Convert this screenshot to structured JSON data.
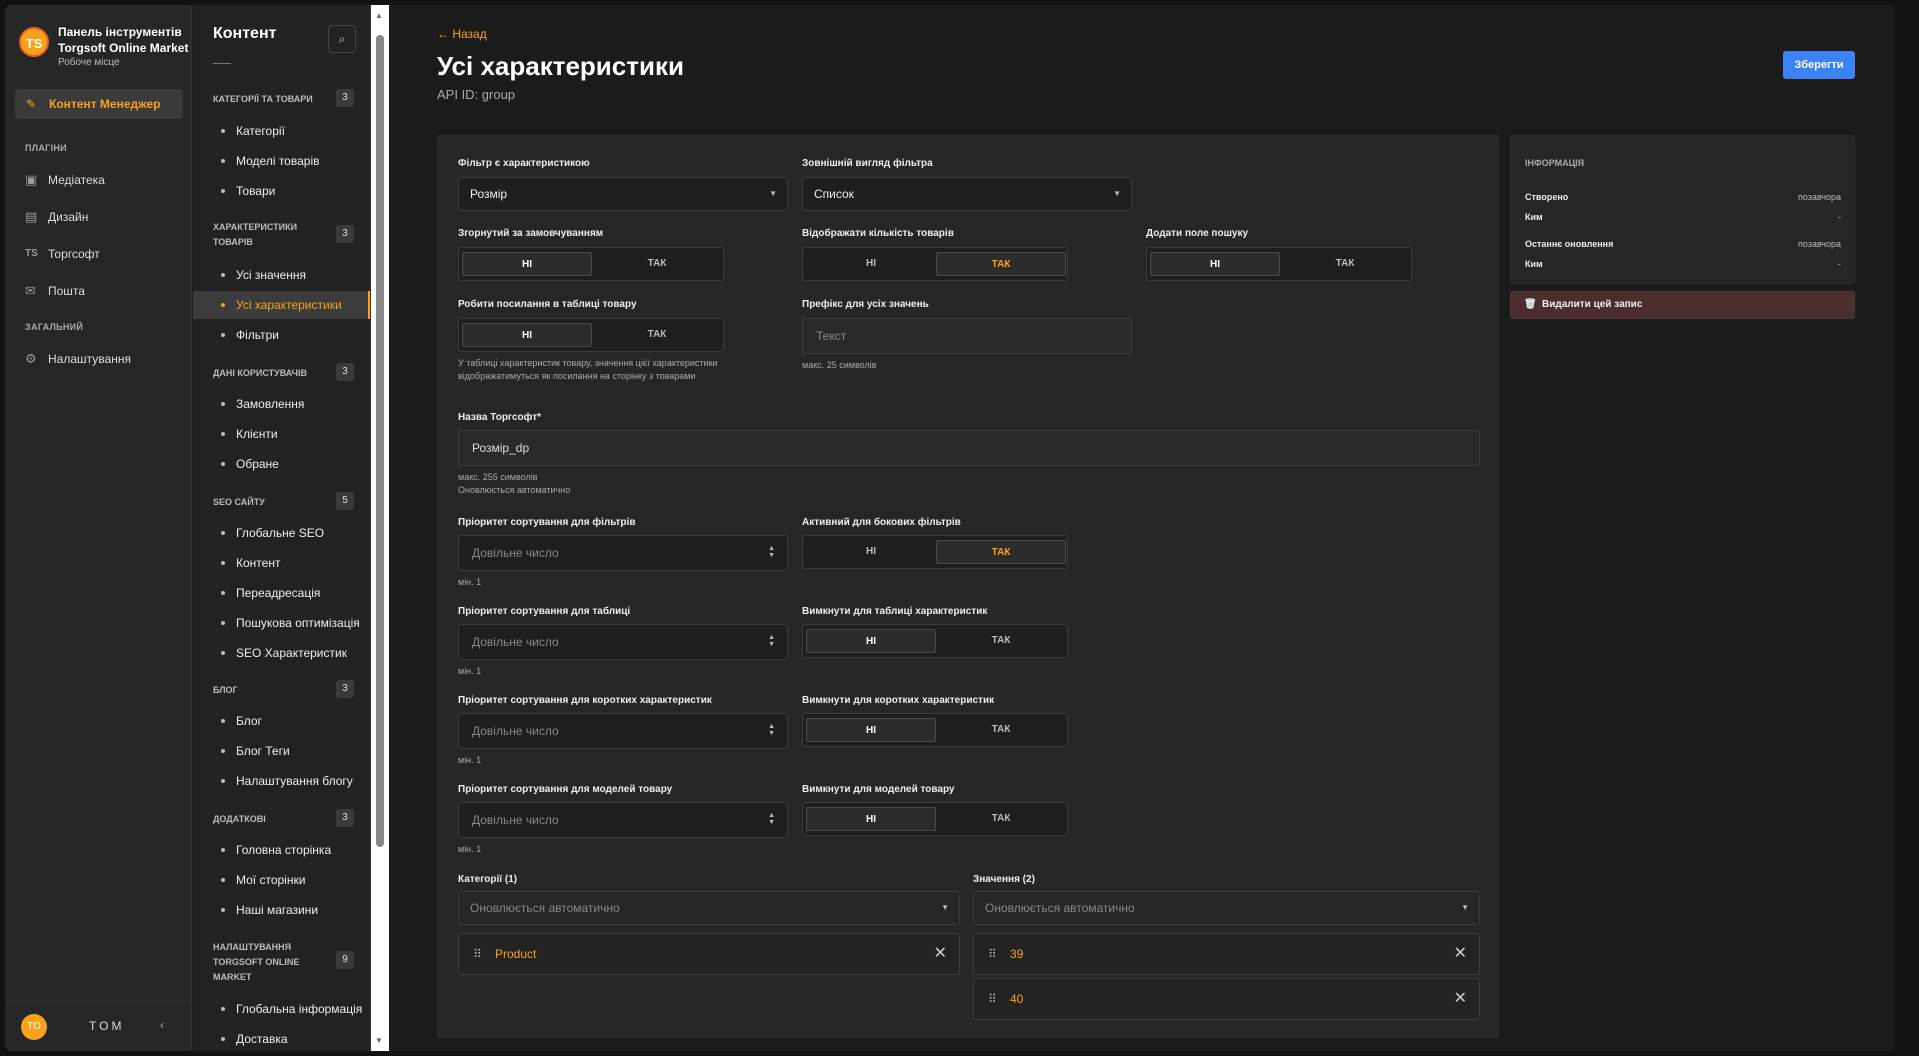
{
  "sidebar": {
    "logo_text": "TS",
    "brand_title": "Панель інструментів Torgsoft Online Market",
    "brand_sub": "Робоче місце",
    "active_item": "Контент Менеджер",
    "plugins_label": "ПЛАГІНИ",
    "plugins": [
      "Медіатека",
      "Дизайн",
      "Торгсофт",
      "Пошта"
    ],
    "general_label": "ЗАГАЛЬНИЙ",
    "settings": "Налаштування",
    "user_initials": "TO",
    "user_name": "TOM"
  },
  "content_panel": {
    "title": "Контент",
    "groups": [
      {
        "title": "КАТЕГОРІЇ ТА ТОВАРИ",
        "count": "3",
        "items": [
          "Категорії",
          "Моделі товарів",
          "Товари"
        ]
      },
      {
        "title": "ХАРАКТЕРИСТИКИ ТОВАРІВ",
        "count": "3",
        "items": [
          "Усі значення",
          "Усі характеристики",
          "Фільтри"
        ]
      },
      {
        "title": "ДАНІ КОРИСТУВАЧІВ",
        "count": "3",
        "items": [
          "Замовлення",
          "Клієнти",
          "Обране"
        ]
      },
      {
        "title": "SEO САЙТУ",
        "count": "5",
        "items": [
          "Глобальне SEO",
          "Контент",
          "Переадресація",
          "Пошукова оптимізація",
          "SEO Характеристик"
        ]
      },
      {
        "title": "БЛОГ",
        "count": "3",
        "items": [
          "Блог",
          "Блог Теги",
          "Налаштування блогу"
        ]
      },
      {
        "title": "ДОДАТКОВІ",
        "count": "3",
        "items": [
          "Головна сторінка",
          "Мої сторінки",
          "Наші магазини"
        ]
      },
      {
        "title": "НАЛАШТУВАННЯ TORGSOFT ONLINE MARKET",
        "count": "9",
        "items": [
          "Глобальна інформація",
          "Доставка"
        ]
      }
    ]
  },
  "header": {
    "back": "Назад",
    "title": "Усі характеристики",
    "api_id": "API ID: group",
    "save": "Зберегти"
  },
  "form": {
    "filter_label": "Фільтр є характеристикою",
    "filter_value": "Розмір",
    "appearance_label": "Зовнішній вигляд фільтра",
    "appearance_value": "Список",
    "collapsed_label": "Згорнутий за замовчуванням",
    "show_count_label": "Відображати кількість товарів",
    "search_label": "Додати поле пошуку",
    "links_label": "Робити посилання в таблиці товару",
    "links_hint": "У таблиці характеристик товару, значення цієї характеристики відображатимуться як посилання на сторінку з товарами",
    "prefix_label": "Префікс для усіх значень",
    "prefix_placeholder": "Текст",
    "prefix_hint": "макс. 25 символів",
    "torgsoft_name_label": "Назва Торгсофт*",
    "torgsoft_name_value": "Розмір_dp",
    "torgsoft_hint1": "макс. 255 символів",
    "torgsoft_hint2": "Оновлюється автоматично",
    "sort_filters_label": "Пріоритет сортування для фільтрів",
    "sort_table_label": "Пріоритет сортування для таблиці",
    "sort_short_label": "Пріоритет сортування для коротких характеристик",
    "sort_models_label": "Пріоритет сортування для моделей товару",
    "number_placeholder": "Довільне число",
    "min_hint": "мін. 1",
    "side_filters_label": "Активний для бокових фільтрів",
    "disable_table_label": "Вимкнути для таблиці характеристик",
    "disable_short_label": "Вимкнути для коротких характеристик",
    "disable_models_label": "Вимкнути для моделей товару",
    "no": "НІ",
    "yes": "ТАК",
    "categories_label": "Категорії (1)",
    "values_label": "Значення (2)",
    "auto_placeholder": "Оновлюється автоматично",
    "category_chip": "Product",
    "value_chips": [
      "39",
      "40"
    ]
  },
  "info": {
    "title": "ІНФОРМАЦІЯ",
    "created": "Створено",
    "created_value": "позавчора",
    "by": "Ким",
    "by_value": "-",
    "updated": "Останнє оновлення",
    "updated_value": "позавчора",
    "delete": "Видалити цей запис"
  },
  "colors": {
    "accent": "#f7a21b",
    "primary": "#3b82f6",
    "danger_bg": "#4a2e2e"
  }
}
